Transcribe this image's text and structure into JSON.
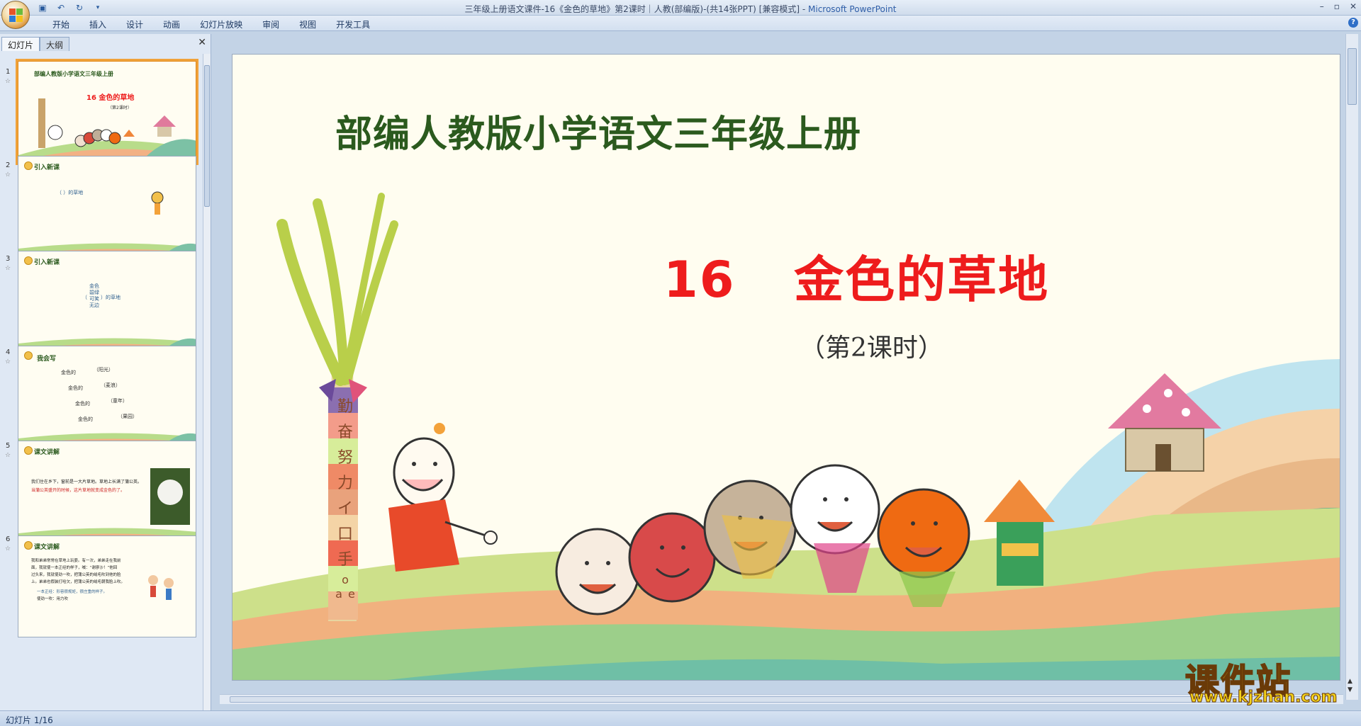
{
  "window": {
    "title_prefix": "三年级上册语文课件-16《金色的草地》第2课时｜人教(部编版)-(共14张PPT) [兼容模式] - ",
    "title_app": "Microsoft PowerPoint",
    "controls": [
      "–",
      "▫",
      "✕"
    ]
  },
  "ribbon": {
    "tabs": [
      "开始",
      "插入",
      "设计",
      "动画",
      "幻灯片放映",
      "审阅",
      "视图",
      "开发工具"
    ]
  },
  "left_pane": {
    "tabs": [
      "幻灯片",
      "大纲"
    ],
    "close": "✕",
    "thumbnails": [
      {
        "num": "1",
        "header": "部编人教版小学语文三年级上册",
        "lines": [
          "16  金色的草地",
          "（第2课时）"
        ]
      },
      {
        "num": "2",
        "header": "引入新课",
        "lines": [
          "（    ）的草地"
        ]
      },
      {
        "num": "3",
        "header": "引入新课",
        "lines": [
          "（",
          "金色",
          "碧绿",
          "可笑",
          "无边",
          "）的草地"
        ]
      },
      {
        "num": "4",
        "header": "我会写",
        "lines": [
          "金色的",
          "（阳光）",
          "金色的",
          "（麦浪）",
          "金色的",
          "（童年）",
          "金色的",
          "（果园）"
        ]
      },
      {
        "num": "5",
        "header": "课文讲解",
        "lines": [
          "我们住在乡下，窗前是一大片草地。草地上长满了蒲公英。",
          "当蒲公英盛开的时候，这片草地就变成金色的了。"
        ]
      },
      {
        "num": "6",
        "header": "课文讲解",
        "lines": [
          "我和弟弟常常在草地上玩耍。有一次，弟弟走在我前",
          "面，我就使一本正经的样子，喊：“谢廖沙！”他回",
          "过头来，我就使劲一吹，把蒲公英的绒毛吹到他的脸",
          "上。弟弟也假装打哈欠，把蒲公英的绒毛朝我脸上吹。",
          "一本正经：形容很规矩，很庄重的样子。",
          "使劲一吹：用力吹"
        ]
      }
    ]
  },
  "slide": {
    "title": "部编人教版小学语文三年级上册",
    "lesson_num": "16",
    "lesson_name": "金色的草地",
    "lesson_sub": "（第2课时）",
    "tree_chars": [
      "勤",
      "奋",
      "努",
      "力",
      "イ",
      "口",
      "手",
      "o",
      "a",
      "e"
    ]
  },
  "status": {
    "text": "幻灯片 1/16"
  },
  "watermark": {
    "cn": "课件站",
    "url": "www.kjzhan.com"
  },
  "colors": {
    "title_green": "#2b5a1e",
    "lesson_red": "#ee1c1c",
    "slide_bg": "#fffdf0"
  }
}
